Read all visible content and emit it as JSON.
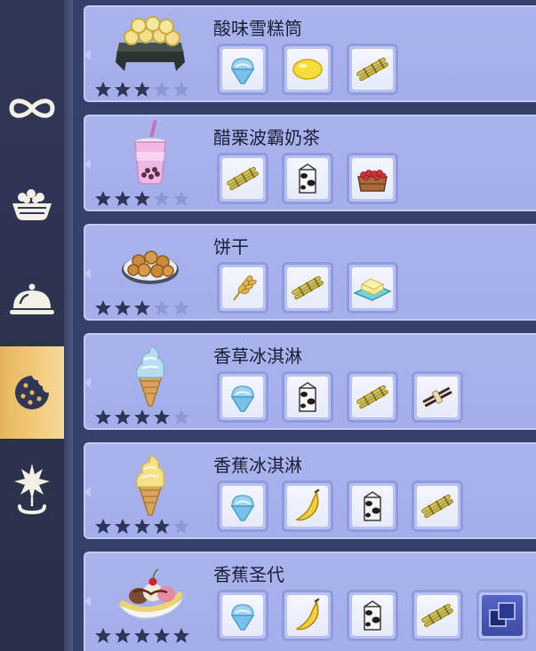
{
  "sidebar": {
    "tabs": [
      {
        "id": "all",
        "icon": "infinity-icon",
        "active": false
      },
      {
        "id": "snacks",
        "icon": "snack-bowl-icon",
        "active": false
      },
      {
        "id": "dishes",
        "icon": "cloche-icon",
        "active": false
      },
      {
        "id": "desserts",
        "icon": "cookie-icon",
        "active": true
      },
      {
        "id": "special",
        "icon": "star-location-icon",
        "active": false
      }
    ],
    "active_color": "#f2ca7a"
  },
  "recipes": [
    {
      "name": "酸味雪糕筒",
      "dish_icon": "cone-tray-icon",
      "stars": 3,
      "max_stars": 5,
      "ingredients": [
        "shaved-ice-icon",
        "lemon-icon",
        "sugarcane-icon"
      ]
    },
    {
      "name": "醋栗波霸奶茶",
      "dish_icon": "bubble-tea-icon",
      "stars": 3,
      "max_stars": 5,
      "ingredients": [
        "sugarcane-icon",
        "milk-carton-icon",
        "gooseberry-crate-icon"
      ]
    },
    {
      "name": "饼干",
      "dish_icon": "biscuit-plate-icon",
      "stars": 3,
      "max_stars": 5,
      "ingredients": [
        "wheat-icon",
        "sugarcane-icon",
        "butter-icon"
      ]
    },
    {
      "name": "香草冰淇淋",
      "dish_icon": "vanilla-ice-cream-icon",
      "stars": 4,
      "max_stars": 5,
      "ingredients": [
        "shaved-ice-icon",
        "milk-carton-icon",
        "sugarcane-icon",
        "vanilla-bean-icon"
      ]
    },
    {
      "name": "香蕉冰淇淋",
      "dish_icon": "banana-ice-cream-icon",
      "stars": 4,
      "max_stars": 5,
      "ingredients": [
        "shaved-ice-icon",
        "banana-icon",
        "milk-carton-icon",
        "sugarcane-icon"
      ]
    },
    {
      "name": "香蕉圣代",
      "dish_icon": "banana-sundae-icon",
      "stars": 5,
      "max_stars": 5,
      "ingredients": [
        "shaved-ice-icon",
        "banana-icon",
        "milk-carton-icon",
        "sugarcane-icon",
        "cube-item-icon"
      ]
    }
  ]
}
